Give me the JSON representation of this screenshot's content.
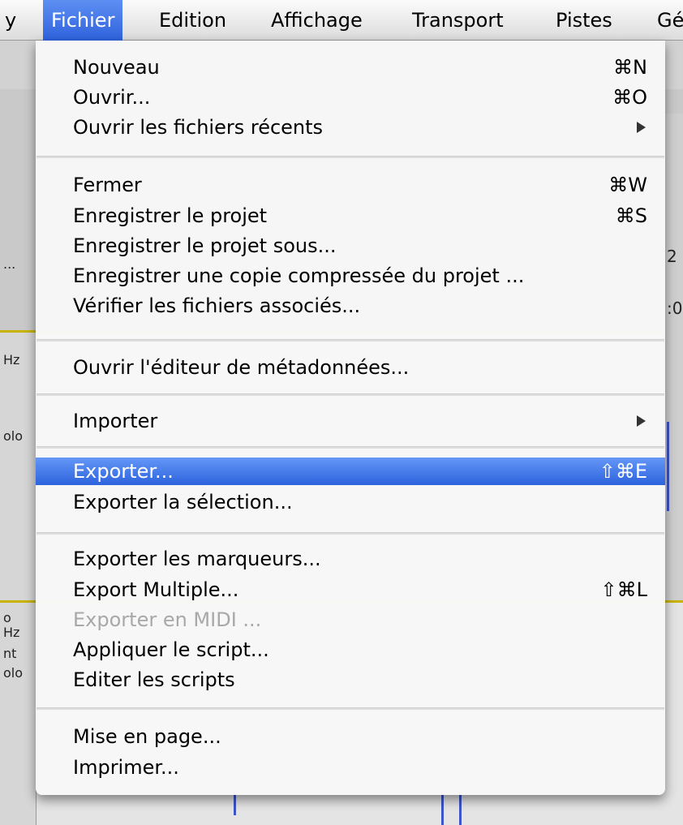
{
  "menubar": {
    "items": [
      {
        "label": "y"
      },
      {
        "label": "Fichier"
      },
      {
        "label": "Edition"
      },
      {
        "label": "Affichage"
      },
      {
        "label": "Transport"
      },
      {
        "label": "Pistes"
      },
      {
        "label": "Gé"
      }
    ]
  },
  "background": {
    "left_texts": [
      "...",
      "Hz",
      "olo",
      "o",
      "Hz",
      "nt",
      "olo"
    ],
    "right_texts": [
      "2",
      ":0"
    ]
  },
  "menu": {
    "items": [
      {
        "label": "Nouveau",
        "shortcut": "⌘N"
      },
      {
        "label": "Ouvrir...",
        "shortcut": "⌘O"
      },
      {
        "label": "Ouvrir les fichiers récents",
        "submenu": true
      },
      {
        "label": "Fermer",
        "shortcut": "⌘W"
      },
      {
        "label": "Enregistrer le projet",
        "shortcut": "⌘S"
      },
      {
        "label": "Enregistrer le projet sous..."
      },
      {
        "label": "Enregistrer une copie compressée du projet ..."
      },
      {
        "label": "Vérifier les fichiers associés..."
      },
      {
        "label": "Ouvrir l'éditeur de métadonnées..."
      },
      {
        "label": "Importer",
        "submenu": true
      },
      {
        "label": "Exporter...",
        "shortcut": "⇧⌘E",
        "highlighted": true
      },
      {
        "label": "Exporter la sélection..."
      },
      {
        "label": "Exporter les marqueurs..."
      },
      {
        "label": "Export Multiple...",
        "shortcut": "⇧⌘L"
      },
      {
        "label": "Exporter en MIDI ...",
        "disabled": true
      },
      {
        "label": "Appliquer le script..."
      },
      {
        "label": "Editer les scripts"
      },
      {
        "label": "Mise en page..."
      },
      {
        "label": "Imprimer..."
      }
    ]
  },
  "colors": {
    "highlight": "#2d63de",
    "disabled_text": "#a8a8a8",
    "waveform": "#3c55c9",
    "track_separator": "#c8b400"
  }
}
